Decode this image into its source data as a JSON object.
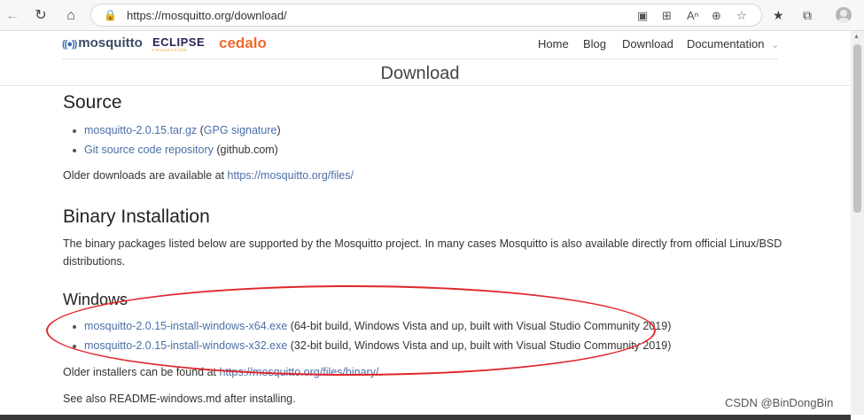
{
  "browser": {
    "url": "https://mosquitto.org/download/",
    "icons": {
      "back": "back-arrow-icon",
      "refresh": "refresh-icon",
      "home": "home-icon",
      "lock": "lock-icon",
      "read_aloud": "read-aloud-icon",
      "apps": "app-grid-icon",
      "text_size": "text-size-icon",
      "zoom": "zoom-icon",
      "favorite_add": "star-add-icon",
      "favorites": "favorites-icon",
      "collections": "collections-icon",
      "profile": "profile-avatar-icon"
    }
  },
  "site": {
    "logos": {
      "mosquitto": "mosquitto",
      "eclipse": "ECLIPSE",
      "eclipse_sub": "FOUNDATION",
      "cedalo": "cedalo"
    },
    "nav": [
      "Home",
      "Blog",
      "Download",
      "Documentation"
    ],
    "page_title": "Download"
  },
  "source": {
    "heading": "Source",
    "items": [
      {
        "link": "mosquitto-2.0.15.tar.gz",
        "mid": " (",
        "link2": "GPG signature",
        "after": ")"
      },
      {
        "link": "Git source code repository",
        "after": " (github.com)"
      }
    ],
    "older_prefix": "Older downloads are available at ",
    "older_link": "https://mosquitto.org/files/"
  },
  "binary": {
    "heading": "Binary Installation",
    "line1": "The binary packages listed below are supported by the Mosquitto project. In many cases Mosquitto is also available directly from official Linux/BSD",
    "line2": "distributions."
  },
  "windows": {
    "heading": "Windows",
    "items": [
      {
        "link": "mosquitto-2.0.15-install-windows-x64.exe",
        "after": " (64-bit build, Windows Vista and up, built with Visual Studio Community 2019)"
      },
      {
        "link": "mosquitto-2.0.15-install-windows-x32.exe",
        "after": " (32-bit build, Windows Vista and up, built with Visual Studio Community 2019)"
      }
    ],
    "older_prefix": "Older installers can be found at ",
    "older_link": "https://mosquitto.org/files/binary/",
    "older_suffix": ".",
    "see_also": "See also README-windows.md after installing."
  },
  "annotation": {
    "color": "#e0262b"
  },
  "watermark": "CSDN @BinDongBin"
}
